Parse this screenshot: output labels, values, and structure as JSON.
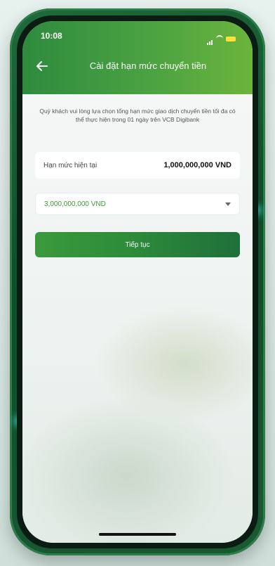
{
  "status_bar": {
    "time": "10:08",
    "icons": [
      "signal-icon",
      "wifi-icon",
      "battery-icon"
    ]
  },
  "nav": {
    "back_icon": "back-arrow-icon",
    "title": "Cài đặt hạn mức chuyển tiền"
  },
  "notice": {
    "text": "Quý khách vui lòng lựa chọn tổng hạn mức giao dịch chuyển tiền tối đa có thể thực hiện trong 01 ngày trên VCB Digibank"
  },
  "current_limit": {
    "label": "Hạn mức hiện tại",
    "value": "1,000,000,000 VND"
  },
  "limit_select": {
    "selected": "3,000,000,000 VND",
    "icon": "chevron-down-icon"
  },
  "actions": {
    "continue_label": "Tiếp tục"
  },
  "colors": {
    "header_start": "#2e8b3d",
    "header_end": "#6cb43c",
    "accent_green": "#3d9b35",
    "button_dark": "#1f6f3a"
  }
}
